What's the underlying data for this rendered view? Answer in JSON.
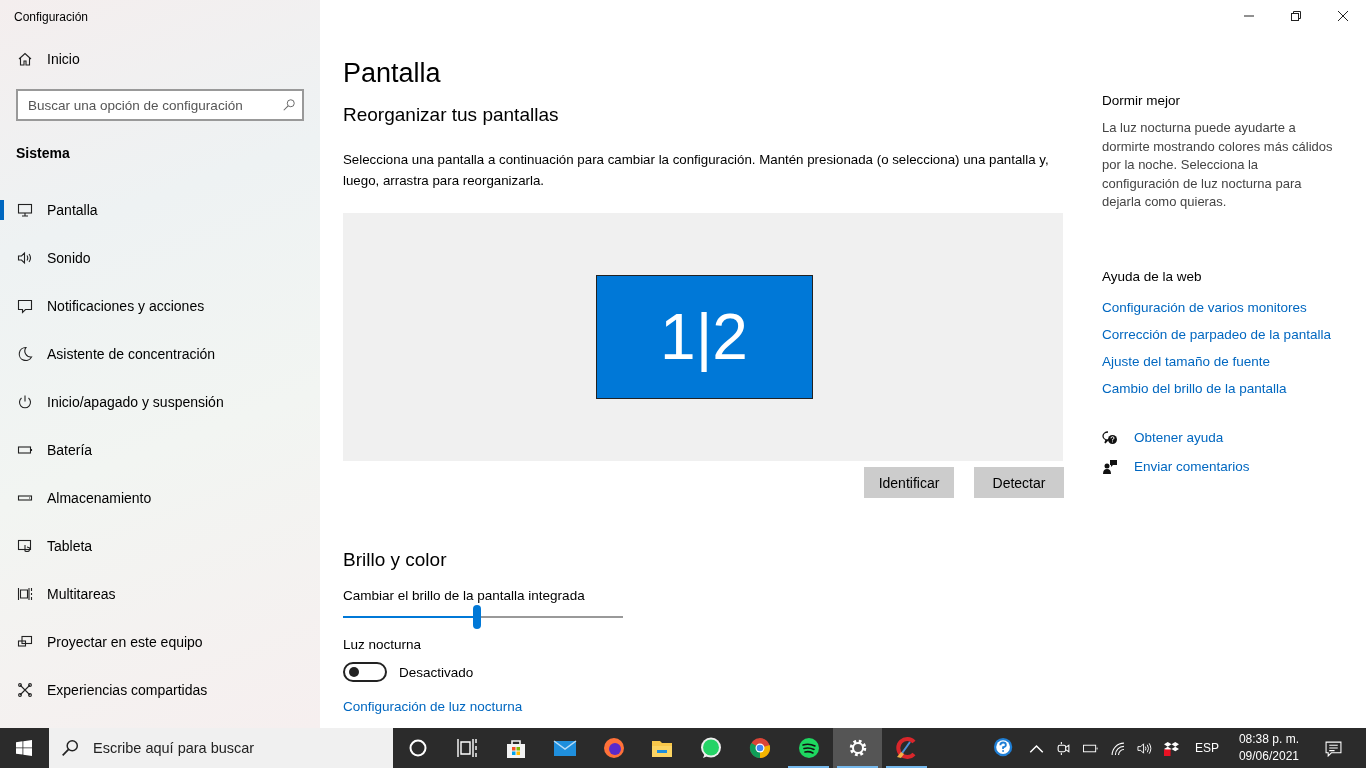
{
  "window": {
    "title": "Configuración"
  },
  "sidebar": {
    "home": "Inicio",
    "search": {
      "placeholder": "Buscar una opción de configuración"
    },
    "section": "Sistema",
    "items": [
      {
        "label": "Pantalla",
        "kind": "display",
        "selected": true
      },
      {
        "label": "Sonido",
        "kind": "sound",
        "selected": false
      },
      {
        "label": "Notificaciones y acciones",
        "kind": "notifications",
        "selected": false
      },
      {
        "label": "Asistente de concentración",
        "kind": "moon",
        "selected": false
      },
      {
        "label": "Inicio/apagado y suspensión",
        "kind": "power",
        "selected": false
      },
      {
        "label": "Batería",
        "kind": "battery",
        "selected": false
      },
      {
        "label": "Almacenamiento",
        "kind": "storage",
        "selected": false
      },
      {
        "label": "Tableta",
        "kind": "tablet",
        "selected": false
      },
      {
        "label": "Multitareas",
        "kind": "multitask",
        "selected": false
      },
      {
        "label": "Proyectar en este equipo",
        "kind": "project",
        "selected": false
      },
      {
        "label": "Experiencias compartidas",
        "kind": "shared",
        "selected": false
      }
    ]
  },
  "main": {
    "title": "Pantalla",
    "arrange": {
      "heading": "Reorganizar tus pantallas",
      "description": "Selecciona una pantalla a continuación para cambiar la configuración. Mantén presionada (o selecciona) una pantalla y, luego, arrastra para reorganizarla.",
      "monitor_label": "1|2",
      "buttons": [
        "Identificar",
        "Detectar"
      ]
    },
    "brightness": {
      "heading": "Brillo y color",
      "slider": {
        "label": "Cambiar el brillo de la pantalla integrada",
        "level": 0.48
      },
      "night_light": {
        "label": "Luz nocturna",
        "on": false,
        "state": "Desactivado"
      },
      "link": "Configuración de luz nocturna"
    }
  },
  "aside": {
    "sleep": {
      "heading": "Dormir mejor",
      "text": "La luz nocturna puede ayudarte a dormirte mostrando colores más cálidos por la noche. Selecciona la configuración de luz nocturna para dejarla como quieras."
    },
    "web_help": {
      "heading": "Ayuda de la web",
      "links": [
        "Configuración de varios monitores",
        "Corrección de parpadeo de la pantalla",
        "Ajuste del tamaño de fuente",
        "Cambio del brillo de la pantalla"
      ]
    },
    "actions": [
      {
        "kind": "help",
        "label": "Obtener ayuda"
      },
      {
        "kind": "feedback",
        "label": "Enviar comentarios"
      }
    ]
  },
  "taskbar": {
    "search": {
      "placeholder": "Escribe aquí para buscar"
    },
    "apps": [
      {
        "kind": "cortana",
        "running": false,
        "selected": false
      },
      {
        "kind": "taskview",
        "running": false,
        "selected": false
      },
      {
        "kind": "store",
        "running": false,
        "selected": false
      },
      {
        "kind": "mail",
        "running": false,
        "selected": false
      },
      {
        "kind": "firefox",
        "running": false,
        "selected": false
      },
      {
        "kind": "explorer",
        "running": false,
        "selected": false
      },
      {
        "kind": "whatsapp",
        "running": false,
        "selected": false
      },
      {
        "kind": "chrome",
        "running": false,
        "selected": false
      },
      {
        "kind": "spotify",
        "running": true,
        "selected": false
      },
      {
        "kind": "settings",
        "running": true,
        "selected": true
      },
      {
        "kind": "ccleaner",
        "running": true,
        "selected": false
      }
    ],
    "tray": {
      "language": "ESP",
      "time": "08:38 p. m.",
      "date": "09/06/2021"
    }
  }
}
